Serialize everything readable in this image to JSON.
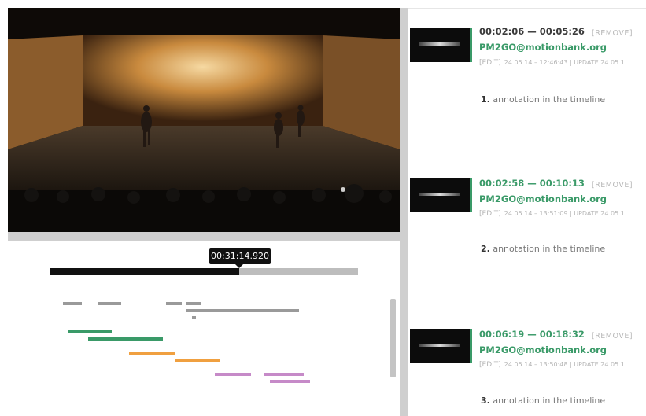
{
  "player": {
    "current_time": "00:31:14.920",
    "progress": 0.615
  },
  "timeline": {
    "tracks": [
      {
        "color": "#9a9a9a",
        "label": "gray"
      },
      {
        "color": "#3a9a68",
        "label": "green"
      },
      {
        "color": "#f0a040",
        "label": "orange"
      },
      {
        "color": "#c68ac8",
        "label": "purple"
      }
    ]
  },
  "annotations": [
    {
      "index": "1.",
      "timecode": "00:02:06 — 00:05:26",
      "remove_label": "[REMOVE]",
      "author": "PM2GO@motionbank.org",
      "edit_label": "[EDIT]",
      "meta": "24.05.14 – 12:46:43 | UPDATE 24.05.1",
      "text": "annotation in the timeline",
      "timecode_color": "#3a3a3a"
    },
    {
      "index": "2.",
      "timecode": "00:02:58 — 00:10:13",
      "remove_label": "[REMOVE]",
      "author": "PM2GO@motionbank.org",
      "edit_label": "[EDIT]",
      "meta": "24.05.14 – 13:51:09 | UPDATE 24.05.1",
      "text": "annotation in the timeline",
      "timecode_color": "#3a9a68"
    },
    {
      "index": "3.",
      "timecode": "00:06:19 — 00:18:32",
      "remove_label": "[REMOVE]",
      "author": "PM2GO@motionbank.org",
      "edit_label": "[EDIT]",
      "meta": "24.05.14 – 13:50:48 | UPDATE 24.05.1",
      "text": "annotation in the timeline",
      "timecode_color": "#3a9a68"
    }
  ]
}
